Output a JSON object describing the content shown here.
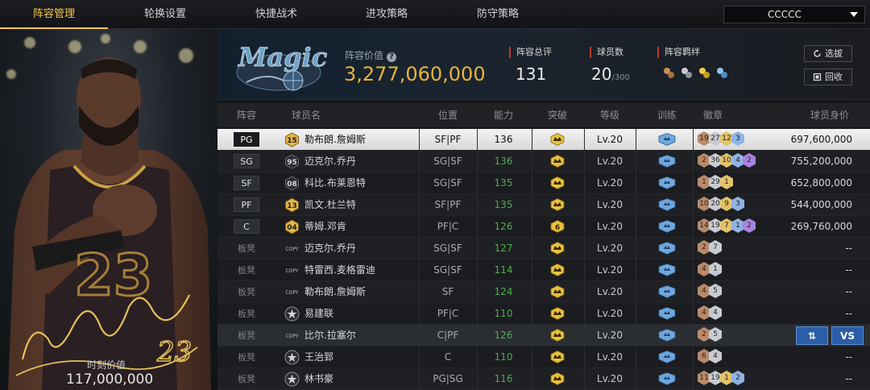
{
  "nav": {
    "tabs": [
      {
        "label": "阵容管理",
        "active": true
      },
      {
        "label": "轮换设置",
        "active": false
      },
      {
        "label": "快捷战术",
        "active": false
      },
      {
        "label": "进攻策略",
        "active": false
      },
      {
        "label": "防守策略",
        "active": false
      }
    ],
    "account_select": "CCCCC"
  },
  "card": {
    "jersey_number": "23",
    "value_label": "时刻价值",
    "value": "117,000,000"
  },
  "header": {
    "lineup_value_label": "阵容价值",
    "lineup_value": "3,277,060,000",
    "overall_label": "阵容总评",
    "overall": "131",
    "players_label": "球员数",
    "players": "20",
    "players_max": "/300",
    "bonds_label": "阵容羁绊",
    "bond_icons": [
      "bond-icon-bronze",
      "bond-icon-silver",
      "bond-icon-gold",
      "bond-icon-blue"
    ],
    "pick_button": "选拔",
    "recycle_button": "回收"
  },
  "table": {
    "columns": [
      "阵容",
      "球员名",
      "位置",
      "能力",
      "突破",
      "等级",
      "训练",
      "徽章",
      "球员身价"
    ],
    "rows": [
      {
        "slot": "PG",
        "number": "15",
        "name": "勒布朗.詹姆斯",
        "position": "SF|PF",
        "ability": "136",
        "level": "Lv.20",
        "badges": [
          "19",
          "27",
          "12",
          "3"
        ],
        "value": "697,600,000",
        "selected": true
      },
      {
        "slot": "SG",
        "number": "95",
        "name": "迈克尔.乔丹",
        "position": "SG|SF",
        "ability": "136",
        "level": "Lv.20",
        "badges": [
          "2",
          "36",
          "10",
          "4",
          "2"
        ],
        "value": "755,200,000"
      },
      {
        "slot": "SF",
        "number": "08",
        "name": "科比.布莱恩特",
        "position": "SG|SF",
        "ability": "135",
        "level": "Lv.20",
        "badges": [
          "1",
          "29",
          "1"
        ],
        "value": "652,800,000"
      },
      {
        "slot": "PF",
        "number": "13",
        "name": "凯文.杜兰特",
        "position": "SF|PF",
        "ability": "135",
        "level": "Lv.20",
        "badges": [
          "10",
          "20",
          "9",
          "3"
        ],
        "value": "544,000,000"
      },
      {
        "slot": "C",
        "number": "04",
        "name": "蒂姆.邓肯",
        "position": "PF|C",
        "ability": "126",
        "level": "Lv.20",
        "breakthrough": "6",
        "badges": [
          "14",
          "19",
          "7",
          "1",
          "2"
        ],
        "value": "269,760,000"
      },
      {
        "slot": "板凳",
        "number": "COPY",
        "name": "迈克尔.乔丹",
        "position": "SG|SF",
        "ability": "127",
        "level": "Lv.20",
        "badges": [
          "2",
          "7"
        ],
        "value": "--"
      },
      {
        "slot": "板凳",
        "number": "COPY",
        "name": "特雷西.麦格雷迪",
        "position": "SG|SF",
        "ability": "114",
        "level": "Lv.20",
        "badges": [
          "4",
          "1"
        ],
        "value": "--"
      },
      {
        "slot": "板凳",
        "number": "COPY",
        "name": "勒布朗.詹姆斯",
        "position": "SF",
        "ability": "124",
        "level": "Lv.20",
        "badges": [
          "4",
          "5"
        ],
        "value": "--"
      },
      {
        "slot": "板凳",
        "number": "star",
        "name": "易建联",
        "position": "PF|C",
        "ability": "110",
        "level": "Lv.20",
        "badges": [
          "4",
          "4"
        ],
        "value": "--"
      },
      {
        "slot": "板凳",
        "number": "COPY",
        "name": "比尔.拉塞尔",
        "position": "C|PF",
        "ability": "126",
        "level": "Lv.20",
        "badges": [
          "2",
          "5"
        ],
        "value": "",
        "actions": [
          "⇅",
          "VS"
        ],
        "highlight": true
      },
      {
        "slot": "板凳",
        "number": "star",
        "name": "王治郅",
        "position": "C",
        "ability": "110",
        "level": "Lv.20",
        "badges": [
          "6",
          "4"
        ],
        "value": "--"
      },
      {
        "slot": "板凳",
        "number": "star",
        "name": "林书豪",
        "position": "PG|SG",
        "ability": "116",
        "level": "Lv.20",
        "badges": [
          "11",
          "19",
          "1",
          "2"
        ],
        "value": "--"
      }
    ]
  },
  "colors": {
    "accent_gold": "#f2c94c",
    "value_gold": "#e8b43a",
    "ability_green": "#4cae4c",
    "action_blue": "#2b5ea8"
  }
}
